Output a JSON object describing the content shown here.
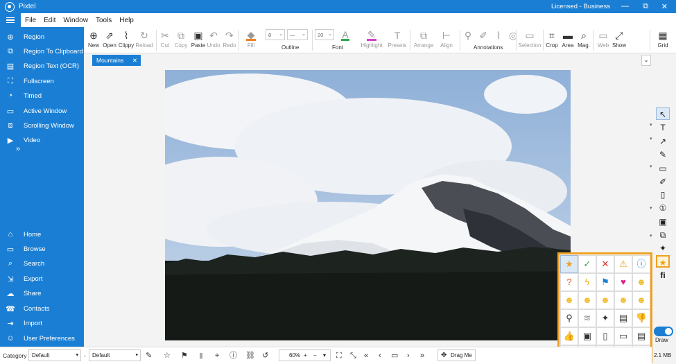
{
  "app": {
    "title": "Pixtel",
    "license": "Licensed - Business",
    "window_min": "—",
    "window_restore": "⧉",
    "window_close": "✕"
  },
  "menu": [
    "File",
    "Edit",
    "Window",
    "Tools",
    "Help"
  ],
  "sidebar": {
    "capture_items": [
      {
        "label": "Region",
        "icon": "crosshair-icon",
        "glyph": "⊕"
      },
      {
        "label": "Region To Clipboard",
        "icon": "clipboard-icon",
        "glyph": "⧉"
      },
      {
        "label": "Region Text (OCR)",
        "icon": "document-text-icon",
        "glyph": "▤"
      },
      {
        "label": "Fullscreen",
        "icon": "fullscreen-icon",
        "glyph": "⛶"
      },
      {
        "label": "Timed",
        "icon": "timer-icon",
        "glyph": "◔"
      },
      {
        "label": "Active Window",
        "icon": "window-icon",
        "glyph": "▭"
      },
      {
        "label": "Scrolling Window",
        "icon": "scroll-window-icon",
        "glyph": "⧈"
      },
      {
        "label": "Video",
        "icon": "video-icon",
        "glyph": "▶"
      }
    ],
    "more": "»",
    "nav_items": [
      {
        "label": "Home",
        "icon": "home-icon",
        "glyph": "⌂"
      },
      {
        "label": "Browse",
        "icon": "browse-icon",
        "glyph": "▭"
      },
      {
        "label": "Search",
        "icon": "search-icon",
        "glyph": "⌕"
      },
      {
        "label": "Export",
        "icon": "export-icon",
        "glyph": "⇲"
      },
      {
        "label": "Share",
        "icon": "share-icon",
        "glyph": "☁"
      },
      {
        "label": "Contacts",
        "icon": "contacts-icon",
        "glyph": "☎"
      },
      {
        "label": "Import",
        "icon": "import-icon",
        "glyph": "⇥"
      },
      {
        "label": "User Preferences",
        "icon": "user-icon",
        "glyph": "☺"
      }
    ]
  },
  "toolbar": {
    "new": "New",
    "open": "Open",
    "clippy": "Clippy",
    "reload": "Reload",
    "cut": "Cut",
    "copy": "Copy",
    "paste": "Paste",
    "undo": "Undo",
    "redo": "Redo",
    "fill": "Fill",
    "outline": "Outline",
    "font": "Font",
    "font_size": "20",
    "outline_width": "8",
    "highlight": "Highlight",
    "presets": "Presets",
    "arrange": "Arrange",
    "align": "Align",
    "annotations": "Annotations",
    "selection": "Selection",
    "crop": "Crop",
    "area": "Area",
    "mag": "Mag.",
    "web": "Web",
    "show": "Show",
    "grid": "Grid"
  },
  "tabs": {
    "active": "Mountains",
    "close": "✕",
    "dropdown": "⌄"
  },
  "palette": {
    "rows": [
      [
        {
          "name": "star-icon",
          "glyph": "★",
          "color": "#f0a020"
        },
        {
          "name": "check-icon",
          "glyph": "✓",
          "color": "#2fa84f"
        },
        {
          "name": "cross-icon",
          "glyph": "✕",
          "color": "#e03030"
        },
        {
          "name": "warning-icon",
          "glyph": "⚠",
          "color": "#f0a020"
        },
        {
          "name": "info-icon",
          "glyph": "ⓘ",
          "color": "#1a7fd4"
        }
      ],
      [
        {
          "name": "question-icon",
          "glyph": "?",
          "color": "#e05020"
        },
        {
          "name": "lightning-icon",
          "glyph": "ϟ",
          "color": "#f0b000"
        },
        {
          "name": "flag-icon",
          "glyph": "⚑",
          "color": "#1a7fd4"
        },
        {
          "name": "heart-icon",
          "glyph": "♥",
          "color": "#e0208a"
        },
        {
          "name": "smiley-icon",
          "glyph": "☻",
          "color": "#f0c030"
        }
      ],
      [
        {
          "name": "grin-emoji-icon",
          "glyph": "☻",
          "color": "#f0c030"
        },
        {
          "name": "smile-emoji-icon",
          "glyph": "☻",
          "color": "#f0c030"
        },
        {
          "name": "neutral-emoji-icon",
          "glyph": "☻",
          "color": "#f0c030"
        },
        {
          "name": "sad-emoji-icon",
          "glyph": "☻",
          "color": "#f0c030"
        },
        {
          "name": "angry-emoji-icon",
          "glyph": "☻",
          "color": "#f0c030"
        }
      ],
      [
        {
          "name": "person-icon",
          "glyph": "⚲",
          "color": "#333333"
        },
        {
          "name": "blur-icon",
          "glyph": "≋",
          "color": "#888888"
        },
        {
          "name": "sparkle-icon",
          "glyph": "✦",
          "color": "#333333"
        },
        {
          "name": "page-icon",
          "glyph": "▤",
          "color": "#333333"
        },
        {
          "name": "thumbs-down-icon",
          "glyph": "👎",
          "color": "#333333"
        }
      ],
      [
        {
          "name": "thumbs-up-icon",
          "glyph": "👍",
          "color": "#333333"
        },
        {
          "name": "id-card-icon",
          "glyph": "▣",
          "color": "#333333"
        },
        {
          "name": "blank-page-icon",
          "glyph": "▯",
          "color": "#333333"
        },
        {
          "name": "monitor-icon",
          "glyph": "▭",
          "color": "#333333"
        },
        {
          "name": "speech-bubble-icon",
          "glyph": "▤",
          "color": "#333333"
        }
      ],
      [
        {
          "name": "laptop-icon",
          "glyph": "▭",
          "color": "#333333"
        },
        {
          "name": "lines-icon",
          "glyph": "≡",
          "color": "#333333"
        },
        {
          "name": "dotted-rect-icon",
          "glyph": "⬚",
          "color": "#333333"
        },
        {
          "name": "at-icon",
          "glyph": "@",
          "color": "#333333"
        },
        {
          "name": "keyboard-icon",
          "glyph": "⌨",
          "color": "#333333"
        }
      ]
    ]
  },
  "right_panel": {
    "draw": "Draw",
    "file_size": "2.1 MB"
  },
  "status": {
    "category_label": "Category",
    "category_value": "Default",
    "dash": "-",
    "default_value": "Default",
    "zoom": "60%"
  },
  "drag_me": "Drag Me"
}
